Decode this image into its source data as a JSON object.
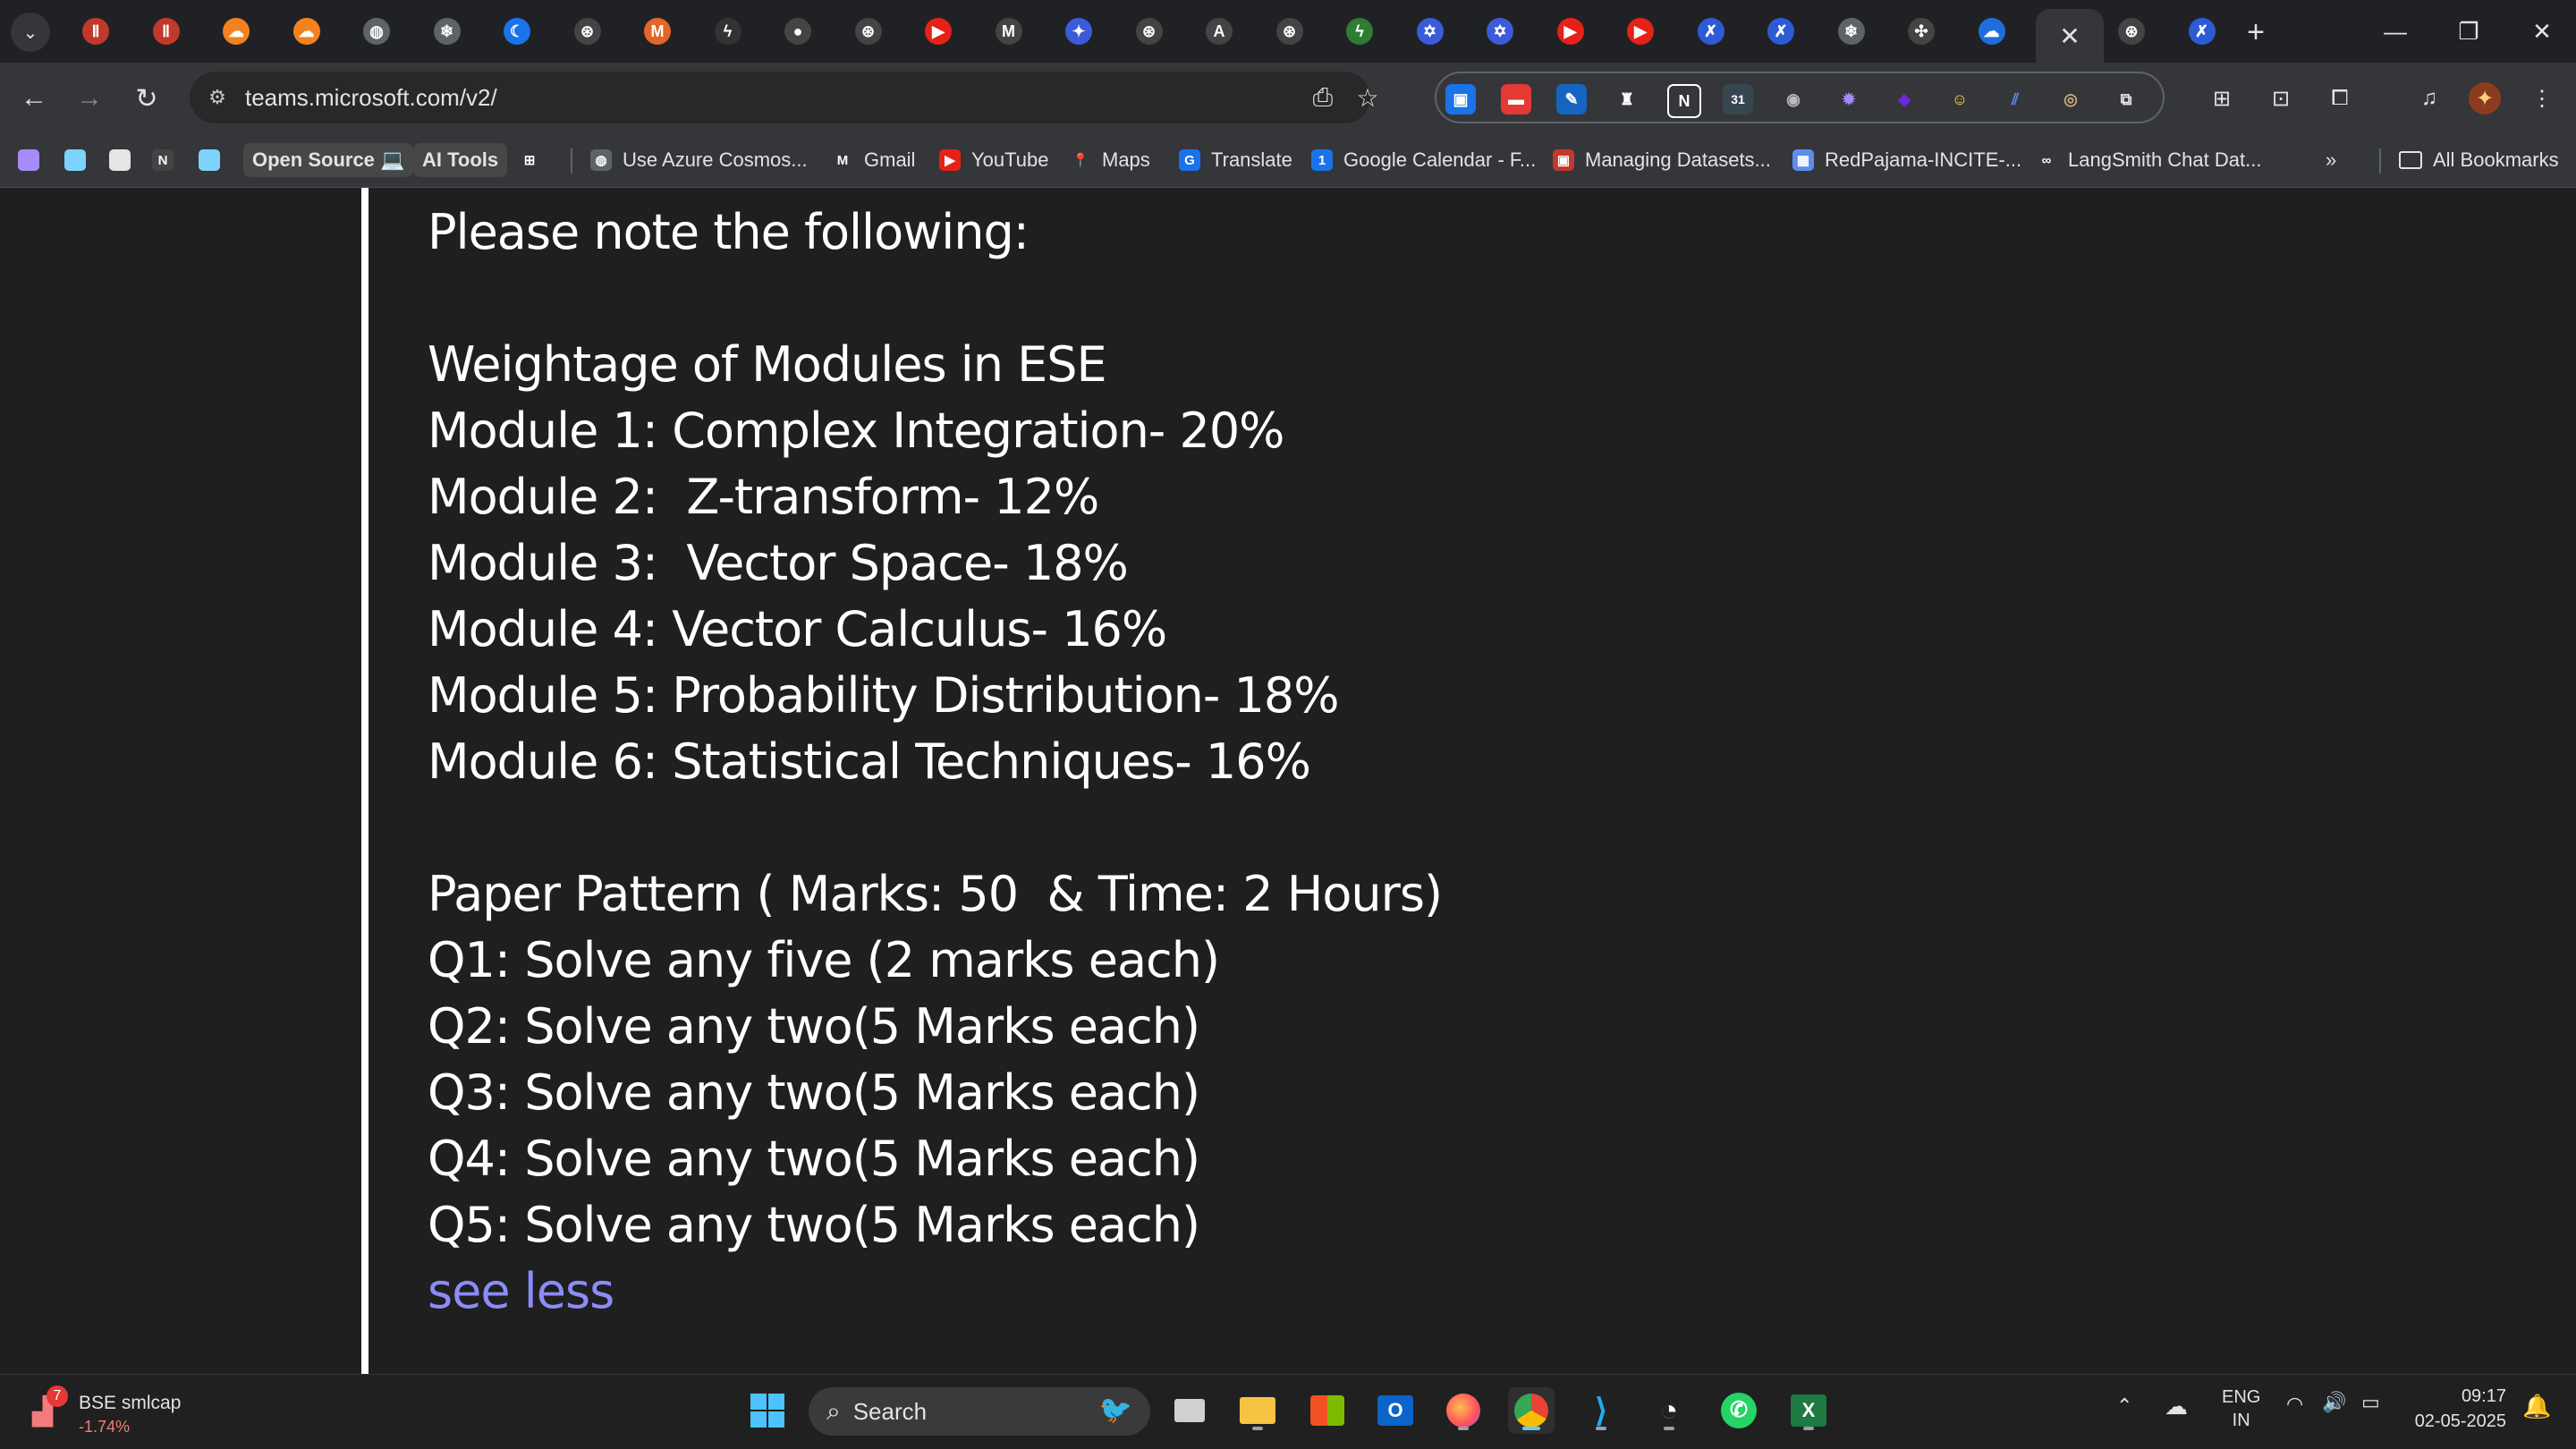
{
  "browser": {
    "tabs": [
      {
        "icon": "red-figure-icon",
        "color": "#c0392b",
        "glyph": "Ⅱ"
      },
      {
        "icon": "red-figure-icon",
        "color": "#c0392b",
        "glyph": "Ⅱ"
      },
      {
        "icon": "cloud-orange-icon",
        "color": "#f48120",
        "glyph": "☁"
      },
      {
        "icon": "cloud-orange-icon",
        "color": "#f48120",
        "glyph": "☁"
      },
      {
        "icon": "globe-icon",
        "color": "#5f6368",
        "glyph": "◍"
      },
      {
        "icon": "snowflake-icon",
        "color": "#5f6368",
        "glyph": "❄"
      },
      {
        "icon": "crescent-icon",
        "color": "#1a73e8",
        "glyph": "☾"
      },
      {
        "icon": "openai-icon",
        "color": "#444",
        "glyph": "⊛"
      },
      {
        "icon": "m-brand-icon",
        "color": "#e2662b",
        "glyph": "M"
      },
      {
        "icon": "bolt-icon",
        "color": "#333",
        "glyph": "ϟ"
      },
      {
        "icon": "github-icon",
        "color": "#444",
        "glyph": "●"
      },
      {
        "icon": "openai-icon",
        "color": "#444",
        "glyph": "⊛"
      },
      {
        "icon": "youtube-icon",
        "color": "#e62117",
        "glyph": "▶"
      },
      {
        "icon": "gmail-icon",
        "color": "#444",
        "glyph": "M"
      },
      {
        "icon": "copilot-icon",
        "color": "#3b5bdb",
        "glyph": "✦"
      },
      {
        "icon": "openai-icon",
        "color": "#444",
        "glyph": "⊛"
      },
      {
        "icon": "anthropic-icon",
        "color": "#444",
        "glyph": "A"
      },
      {
        "icon": "openai-icon",
        "color": "#444",
        "glyph": "⊛"
      },
      {
        "icon": "bolt-green-icon",
        "color": "#2e7d32",
        "glyph": "ϟ"
      },
      {
        "icon": "star-badge-icon",
        "color": "#3b5bdb",
        "glyph": "✡"
      },
      {
        "icon": "star-badge-icon",
        "color": "#3b5bdb",
        "glyph": "✡"
      },
      {
        "icon": "youtube-icon",
        "color": "#e62117",
        "glyph": "▶"
      },
      {
        "icon": "youtube-icon",
        "color": "#e62117",
        "glyph": "▶"
      },
      {
        "icon": "butterfly-icon",
        "color": "#2d5bd6",
        "glyph": "✗"
      },
      {
        "icon": "butterfly-icon",
        "color": "#2d5bd6",
        "glyph": "✗"
      },
      {
        "icon": "snowflake-icon",
        "color": "#5f6368",
        "glyph": "❄"
      },
      {
        "icon": "windmill-icon",
        "color": "#444",
        "glyph": "✣"
      },
      {
        "icon": "onedrive-icon",
        "color": "#1e6fd9",
        "glyph": "☁"
      },
      {
        "icon": "close-icon",
        "color": "transparent",
        "glyph": "✕",
        "active": true
      },
      {
        "icon": "openai-icon",
        "color": "#444",
        "glyph": "⊛"
      },
      {
        "icon": "butterfly-icon",
        "color": "#2d5bd6",
        "glyph": "✗"
      }
    ],
    "url": "teams.microsoft.com/v2/",
    "bookmarks": [
      {
        "label": "",
        "icon": "purple-square-icon",
        "color": "#a78bfa"
      },
      {
        "label": "",
        "icon": "cyan-square-icon",
        "color": "#7dd3fc"
      },
      {
        "label": "",
        "icon": "white-square-icon",
        "color": "#e5e5e5"
      },
      {
        "label": "",
        "icon": "notion-icon",
        "color": "#444",
        "glyph": "N"
      },
      {
        "label": "",
        "icon": "cyan-square-icon",
        "color": "#7dd3fc"
      },
      {
        "label": "Open Source 💻",
        "icon": "",
        "pill": true
      },
      {
        "label": "AI Tools",
        "icon": "",
        "pill": true
      },
      {
        "label": "",
        "icon": "apps-grid-icon",
        "color": "transparent",
        "glyph": "⊞"
      },
      {
        "label": "Use Azure Cosmos...",
        "icon": "globe-icon",
        "color": "#5f6368",
        "glyph": "◍"
      },
      {
        "label": "Gmail",
        "icon": "gmail-icon",
        "color": "transparent",
        "glyph": "M"
      },
      {
        "label": "YouTube",
        "icon": "youtube-icon",
        "color": "#e62117",
        "glyph": "▶"
      },
      {
        "label": "Maps",
        "icon": "maps-pin-icon",
        "color": "transparent",
        "glyph": "📍"
      },
      {
        "label": "Translate",
        "icon": "translate-icon",
        "color": "#1a73e8",
        "glyph": "G"
      },
      {
        "label": "Google Calendar - F...",
        "icon": "calendar-icon",
        "color": "#1a73e8",
        "glyph": "1"
      },
      {
        "label": "Managing Datasets...",
        "icon": "datasets-icon",
        "color": "#c0392b",
        "glyph": "▣"
      },
      {
        "label": "RedPajama-INCITE-...",
        "icon": "redpajama-icon",
        "color": "#5b8def",
        "glyph": "▦"
      },
      {
        "label": "LangSmith Chat Dat...",
        "icon": "langsmith-icon",
        "color": "transparent",
        "glyph": "∞"
      }
    ],
    "all_bookmarks_label": "All Bookmarks"
  },
  "message": {
    "lines": [
      "Please note the following:",
      "",
      "Weightage of Modules in ESE",
      "Module 1: Complex Integration- 20%",
      "Module 2:  Z-transform- 12%",
      "Module 3:  Vector Space- 18%",
      "Module 4: Vector Calculus- 16%",
      "Module 5: Probability Distribution- 18%",
      "Module 6: Statistical Techniques- 16%",
      "",
      "Paper Pattern ( Marks: 50  & Time: 2 Hours)",
      "Q1: Solve any five (2 marks each)",
      "Q2: Solve any two(5 Marks each)",
      "Q3: Solve any two(5 Marks each)",
      "Q4: Solve any two(5 Marks each)",
      "Q5: Solve any two(5 Marks each)"
    ],
    "see_less": "see less"
  },
  "taskbar": {
    "widget": {
      "title": "BSE smlcap",
      "change": "-1.74%",
      "badge": "7"
    },
    "search_label": "Search",
    "lang": {
      "line1": "ENG",
      "line2": "IN"
    },
    "time": "09:17",
    "date": "02-05-2025"
  },
  "colors": {
    "link": "#8b8cf7",
    "accent_bar": "#ffffff",
    "stock_down": "#f47b7b"
  }
}
